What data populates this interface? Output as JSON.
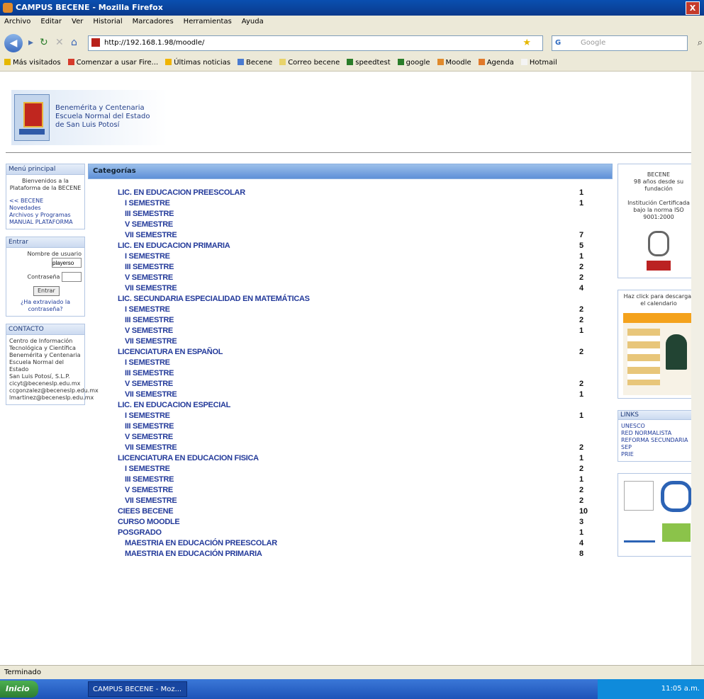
{
  "window": {
    "title": "CAMPUS BECENE - Mozilla Firefox",
    "close_label": "X"
  },
  "menu": [
    "Archivo",
    "Editar",
    "Ver",
    "Historial",
    "Marcadores",
    "Herramientas",
    "Ayuda"
  ],
  "nav": {
    "url": "http://192.168.1.98/moodle/",
    "search_placeholder": "Google",
    "search_engine": "G"
  },
  "bookmarks": [
    "Más visitados",
    "Comenzar a usar Fire...",
    "Últimas noticias",
    "Becene",
    "Correo becene",
    "speedtest",
    "google",
    "Moodle",
    "Agenda",
    "Hotmail"
  ],
  "header": {
    "logo_line1": "Benemérita y Centenaria",
    "logo_line2": "Escuela Normal del Estado",
    "logo_line3": "de San Luis Potosí"
  },
  "left": {
    "main_menu_title": "Menú principal",
    "welcome": "Bienvenidos a la Plataforma de la BECENE",
    "links": [
      "<< BECENE",
      "Novedades",
      "Archivos y Programas",
      "MANUAL PLATAFORMA"
    ],
    "login_title": "Entrar",
    "username_label": "Nombre de usuario",
    "username_value": "playerso",
    "password_label": "Contraseña",
    "login_button": "Entrar",
    "forgot": "¿Ha extraviado la contraseña?",
    "contact_title": "CONTACTO",
    "contact_lines": [
      "Centro de Información",
      "Tecnológica y Científica",
      "Benemérita y Centenaria",
      "Escuela Normal del Estado",
      "San Luis Potosí, S.L.P.",
      "cicyt@beceneslp.edu.mx",
      "ccgonzalez@beceneslp.edu.mx",
      "lmartinez@beceneslp.edu.mx"
    ]
  },
  "categories_title": "Categorías",
  "categories": [
    {
      "name": "LIC. EN EDUCACION PREESCOLAR",
      "count": "1",
      "level": 0
    },
    {
      "name": "I SEMESTRE",
      "count": "1",
      "level": 1
    },
    {
      "name": "III SEMESTRE",
      "count": "",
      "level": 1
    },
    {
      "name": "V SEMESTRE",
      "count": "",
      "level": 1
    },
    {
      "name": "VII SEMESTRE",
      "count": "7",
      "level": 1
    },
    {
      "name": "LIC. EN EDUCACION PRIMARIA",
      "count": "5",
      "level": 0
    },
    {
      "name": "I SEMESTRE",
      "count": "1",
      "level": 1
    },
    {
      "name": "III SEMESTRE",
      "count": "2",
      "level": 1
    },
    {
      "name": "V SEMESTRE",
      "count": "2",
      "level": 1
    },
    {
      "name": "VII SEMESTRE",
      "count": "4",
      "level": 1
    },
    {
      "name": "LIC. SECUNDARIA ESPECIALIDAD EN MATEMÁTICAS",
      "count": "",
      "level": 0
    },
    {
      "name": "I SEMESTRE",
      "count": "2",
      "level": 1
    },
    {
      "name": "III SEMESTRE",
      "count": "2",
      "level": 1
    },
    {
      "name": "V SEMESTRE",
      "count": "1",
      "level": 1
    },
    {
      "name": "VII SEMESTRE",
      "count": "",
      "level": 1
    },
    {
      "name": "LICENCIATURA EN ESPAÑOL",
      "count": "2",
      "level": 0
    },
    {
      "name": "I SEMESTRE",
      "count": "",
      "level": 1
    },
    {
      "name": "III SEMESTRE",
      "count": "",
      "level": 1
    },
    {
      "name": "V SEMESTRE",
      "count": "2",
      "level": 1
    },
    {
      "name": "VII SEMESTRE",
      "count": "1",
      "level": 1
    },
    {
      "name": "LIC. EN EDUCACION ESPECIAL",
      "count": "",
      "level": 0
    },
    {
      "name": "I SEMESTRE",
      "count": "1",
      "level": 1
    },
    {
      "name": "III SEMESTRE",
      "count": "",
      "level": 1
    },
    {
      "name": "V SEMESTRE",
      "count": "",
      "level": 1
    },
    {
      "name": "VII SEMESTRE",
      "count": "2",
      "level": 1
    },
    {
      "name": "LICENCIATURA EN EDUCACION FISICA",
      "count": "1",
      "level": 0
    },
    {
      "name": "I SEMESTRE",
      "count": "2",
      "level": 1
    },
    {
      "name": "III SEMESTRE",
      "count": "1",
      "level": 1
    },
    {
      "name": "V SEMESTRE",
      "count": "2",
      "level": 1
    },
    {
      "name": "VII SEMESTRE",
      "count": "2",
      "level": 1
    },
    {
      "name": "CIEES BECENE",
      "count": "10",
      "level": 0
    },
    {
      "name": "CURSO MOODLE",
      "count": "3",
      "level": 0
    },
    {
      "name": "POSGRADO",
      "count": "1",
      "level": 0
    },
    {
      "name": "MAESTRIA EN EDUCACIÓN PREESCOLAR",
      "count": "4",
      "level": 1
    },
    {
      "name": "MAESTRIA EN EDUCACIÓN PRIMARIA",
      "count": "8",
      "level": 1
    }
  ],
  "right": {
    "becene_title": "BECENE",
    "becene_sub": "98 años desde su fundación",
    "cert_text": "Institución Certificada bajo la norma ISO 9001:2000",
    "calendar_text": "Haz click para descargar el calendario",
    "links_title": "LINKS",
    "links": [
      "UNESCO",
      "RED NORMALISTA",
      "REFORMA SECUNDARIA",
      "SEP",
      "PRIE"
    ]
  },
  "status": "Terminado",
  "taskbar": {
    "start": "Inicio",
    "task": "CAMPUS BECENE - Moz...",
    "clock": "11:05 a.m."
  }
}
